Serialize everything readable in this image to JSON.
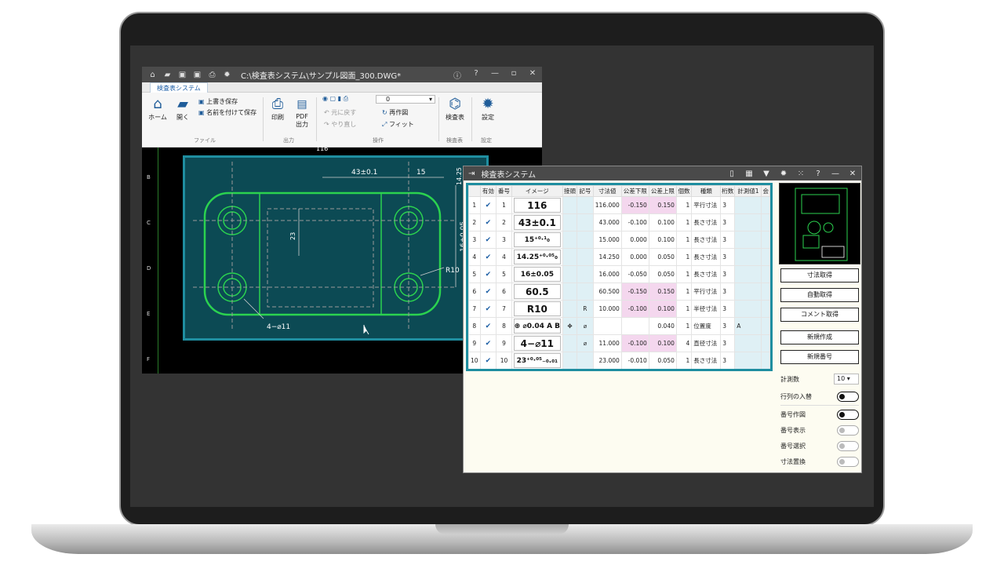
{
  "cad": {
    "title_path": "C:\\検査表システム\\サンプル図面_300.DWG*",
    "tab": "検査表システム",
    "ribbon": {
      "home": "ホーム",
      "open": "開く",
      "overwrite_save": "上書き保存",
      "save_as": "名前を付けて保存",
      "print": "印刷",
      "pdf_line1": "PDF",
      "pdf_line2": "出力",
      "undo": "元に戻す",
      "redo": "やり直し",
      "layer_value": "0",
      "redraw": "再作図",
      "fit": "フィット",
      "inspection": "検査表",
      "settings": "設定"
    },
    "groups": [
      "ファイル",
      "出力",
      "操作",
      "検査表",
      "設定"
    ],
    "row_letters": [
      "B",
      "C",
      "D",
      "E",
      "F"
    ],
    "drawing": {
      "dim_116": "116",
      "dim_43": "43±0.1",
      "dim_15": "15",
      "dim_1425": "14.25",
      "dim_16": "16±0.05",
      "dim_23": "23",
      "r10": "R10",
      "hole": "4−⌀11"
    }
  },
  "insp": {
    "title": "検査表システム",
    "headers": [
      "有効",
      "番号",
      "イメージ",
      "接頭",
      "記号",
      "寸法値",
      "公差下限",
      "公差上限",
      "個数",
      "種類",
      "桁数",
      "計測値1",
      "会"
    ],
    "rows": [
      {
        "no": "1",
        "num": "1",
        "img": "116",
        "prefix": "",
        "sym": "",
        "val": "116.000",
        "low": "-0.150",
        "up": "0.150",
        "cnt": "1",
        "kind": "平行寸法",
        "dig": "3",
        "m1": ""
      },
      {
        "no": "2",
        "num": "2",
        "img": "43±0.1",
        "prefix": "",
        "sym": "",
        "val": "43.000",
        "low": "-0.100",
        "up": "0.100",
        "cnt": "1",
        "kind": "長さ寸法",
        "dig": "3",
        "m1": ""
      },
      {
        "no": "3",
        "num": "3",
        "img": "15⁺⁰·¹₀",
        "prefix": "",
        "sym": "",
        "val": "15.000",
        "low": "0.000",
        "up": "0.100",
        "cnt": "1",
        "kind": "長さ寸法",
        "dig": "3",
        "m1": ""
      },
      {
        "no": "4",
        "num": "4",
        "img": "14.25⁺⁰·⁰⁵₀",
        "prefix": "",
        "sym": "",
        "val": "14.250",
        "low": "0.000",
        "up": "0.050",
        "cnt": "1",
        "kind": "長さ寸法",
        "dig": "3",
        "m1": ""
      },
      {
        "no": "5",
        "num": "5",
        "img": "16±0.05",
        "prefix": "",
        "sym": "",
        "val": "16.000",
        "low": "-0.050",
        "up": "0.050",
        "cnt": "1",
        "kind": "長さ寸法",
        "dig": "3",
        "m1": ""
      },
      {
        "no": "6",
        "num": "6",
        "img": "60.5",
        "prefix": "",
        "sym": "",
        "val": "60.500",
        "low": "-0.150",
        "up": "0.150",
        "cnt": "1",
        "kind": "平行寸法",
        "dig": "3",
        "m1": ""
      },
      {
        "no": "7",
        "num": "7",
        "img": "R10",
        "prefix": "",
        "sym": "R",
        "val": "10.000",
        "low": "-0.100",
        "up": "0.100",
        "cnt": "1",
        "kind": "半径寸法",
        "dig": "3",
        "m1": ""
      },
      {
        "no": "8",
        "num": "8",
        "img": "⊕ ⌀0.04 A B",
        "prefix": "✥",
        "sym": "⌀",
        "val": "",
        "low": "",
        "up": "0.040",
        "cnt": "1",
        "kind": "位置度",
        "dig": "3",
        "m1": "A"
      },
      {
        "no": "9",
        "num": "9",
        "img": "4−⌀11",
        "prefix": "",
        "sym": "⌀",
        "val": "11.000",
        "low": "-0.100",
        "up": "0.100",
        "cnt": "4",
        "kind": "直径寸法",
        "dig": "3",
        "m1": ""
      },
      {
        "no": "10",
        "num": "10",
        "img": "23⁺⁰·⁰⁵₋₀.₀₁",
        "prefix": "",
        "sym": "",
        "val": "23.000",
        "low": "-0.010",
        "up": "0.050",
        "cnt": "1",
        "kind": "長さ寸法",
        "dig": "3",
        "m1": ""
      }
    ],
    "buttons": [
      "寸法取得",
      "自動取得",
      "コメント取得",
      "新規作成",
      "新規番号"
    ],
    "count_label": "計測数",
    "count_value": "10",
    "toggles": [
      "行列の入替",
      "番号作図",
      "番号表示",
      "番号選択",
      "寸法置換"
    ]
  }
}
